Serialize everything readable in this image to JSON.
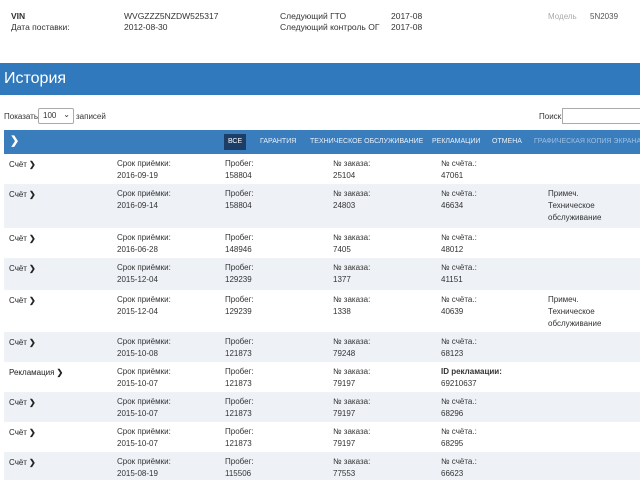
{
  "vehicle": {
    "vin_label": "VIN",
    "vin_value": "WVGZZZ5NZDW525317",
    "delivery_label": "Дата поставки:",
    "delivery_value": "2012-08-30",
    "next_gto_label": "Следующий ГТО",
    "next_gto_value": "2017-08",
    "next_og_label": "Следующий контроль ОГ",
    "next_og_value": "2017-08",
    "model_label": "Модель",
    "model_value": "5N2039"
  },
  "history": {
    "title": "История"
  },
  "controls": {
    "show_label": "Показать",
    "records_value": "100",
    "records_label": "записей",
    "search_label": "Поиск:"
  },
  "filters": [
    {
      "label": "Все"
    },
    {
      "label": "Гарантия"
    },
    {
      "label": "Техническое обслуживание"
    },
    {
      "label": "Рекламации"
    },
    {
      "label": "Отмена"
    },
    {
      "label": "Графическая копия экрана"
    }
  ],
  "rows": [
    {
      "type": "Счёт",
      "date_label": "Срок приёмки:",
      "date": "2016-09-19",
      "mileage_label": "Пробег:",
      "mileage": "158804",
      "order_label": "№ заказа:",
      "order": "25104",
      "invoice_label": "№ счёта.:",
      "invoice": "47061",
      "note_label": "",
      "note": ""
    },
    {
      "type": "Счёт",
      "date_label": "Срок приёмки:",
      "date": "2016-09-14",
      "mileage_label": "Пробег:",
      "mileage": "158804",
      "order_label": "№ заказа:",
      "order": "24803",
      "invoice_label": "№ счёта.:",
      "invoice": "46634",
      "note_label": "Примеч.",
      "note": "Техническое обслуживание"
    },
    {
      "type": "Счёт",
      "date_label": "Срок приёмки:",
      "date": "2016-06-28",
      "mileage_label": "Пробег:",
      "mileage": "148946",
      "order_label": "№ заказа:",
      "order": "7405",
      "invoice_label": "№ счёта.:",
      "invoice": "48012",
      "note_label": "",
      "note": ""
    },
    {
      "type": "Счёт",
      "date_label": "Срок приёмки:",
      "date": "2015-12-04",
      "mileage_label": "Пробег:",
      "mileage": "129239",
      "order_label": "№ заказа:",
      "order": "1377",
      "invoice_label": "№ счёта.:",
      "invoice": "41151",
      "note_label": "",
      "note": ""
    },
    {
      "type": "Счёт",
      "date_label": "Срок приёмки:",
      "date": "2015-12-04",
      "mileage_label": "Пробег:",
      "mileage": "129239",
      "order_label": "№ заказа:",
      "order": "1338",
      "invoice_label": "№ счёта.:",
      "invoice": "40639",
      "note_label": "Примеч.",
      "note": "Техническое обслуживание"
    },
    {
      "type": "Счёт",
      "date_label": "Срок приёмки:",
      "date": "2015-10-08",
      "mileage_label": "Пробег:",
      "mileage": "121873",
      "order_label": "№ заказа:",
      "order": "79248",
      "invoice_label": "№ счёта.:",
      "invoice": "68123",
      "note_label": "",
      "note": ""
    },
    {
      "type": "Рекламация",
      "date_label": "Срок приёмки:",
      "date": "2015-10-07",
      "mileage_label": "Пробег:",
      "mileage": "121873",
      "order_label": "№ заказа:",
      "order": "79197",
      "invoice_label": "ID рекламации:",
      "invoice": "69210637",
      "note_label": "",
      "note": ""
    },
    {
      "type": "Счёт",
      "date_label": "Срок приёмки:",
      "date": "2015-10-07",
      "mileage_label": "Пробег:",
      "mileage": "121873",
      "order_label": "№ заказа:",
      "order": "79197",
      "invoice_label": "№ счёта.:",
      "invoice": "68296",
      "note_label": "",
      "note": ""
    },
    {
      "type": "Счёт",
      "date_label": "Срок приёмки:",
      "date": "2015-10-07",
      "mileage_label": "Пробег:",
      "mileage": "121873",
      "order_label": "№ заказа:",
      "order": "79197",
      "invoice_label": "№ счёта.:",
      "invoice": "68295",
      "note_label": "",
      "note": ""
    },
    {
      "type": "Счёт",
      "date_label": "Срок приёмки:",
      "date": "2015-08-19",
      "mileage_label": "Пробег:",
      "mileage": "115506",
      "order_label": "№ заказа:",
      "order": "77553",
      "invoice_label": "№ счёта.:",
      "invoice": "66623",
      "note_label": "",
      "note": ""
    }
  ]
}
